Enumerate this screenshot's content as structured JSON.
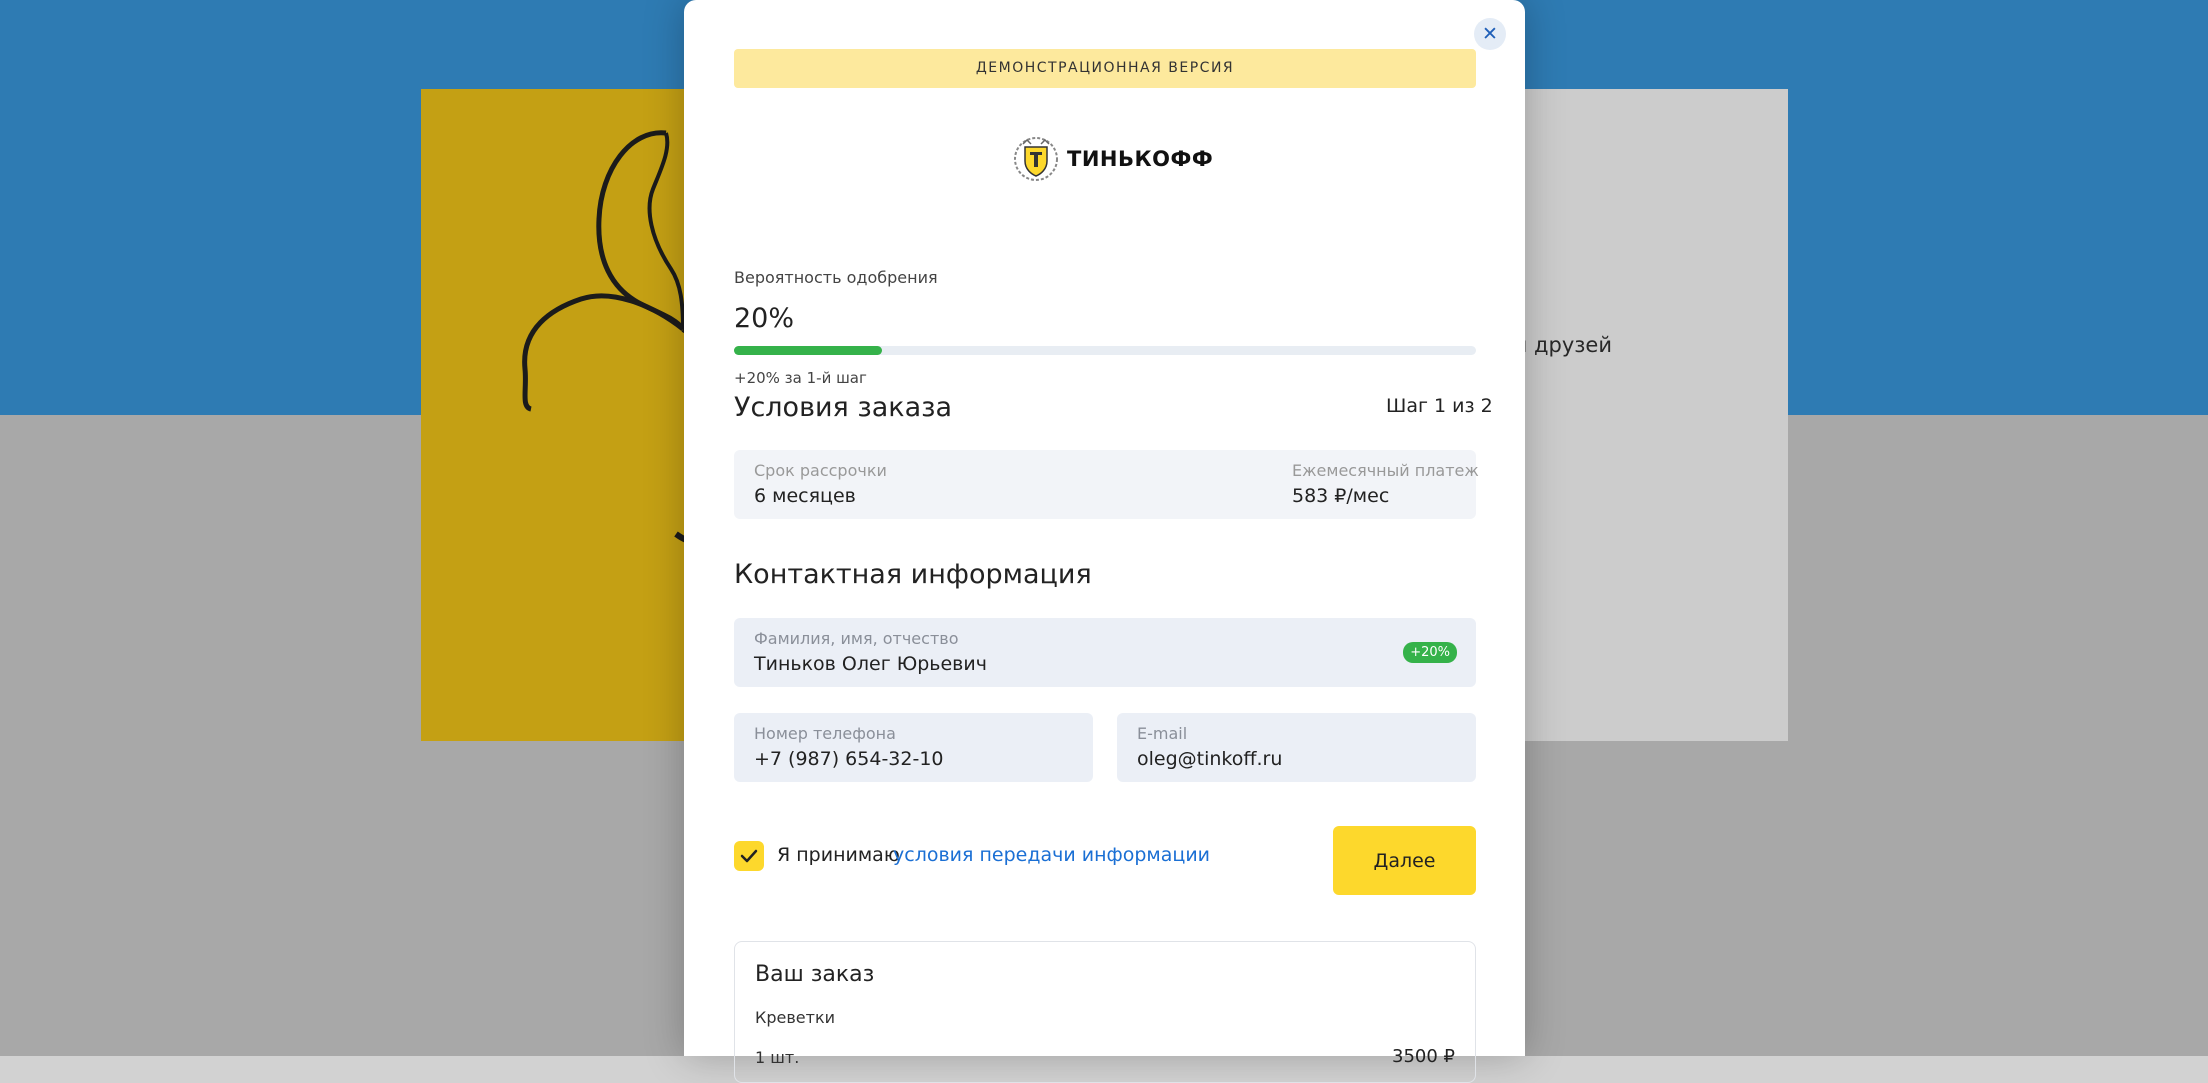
{
  "background": {
    "right_card_text": "ии друзей"
  },
  "modal": {
    "close_icon": "close-icon",
    "demo_banner": "ДЕМОНСТРАЦИОННАЯ ВЕРСИЯ",
    "logo_text": "ТИНЬКОФФ",
    "approval": {
      "label": "Вероятность одобрения",
      "value": "20%",
      "progress_fraction": 0.2,
      "hint": "+20% за 1-й шаг"
    },
    "order_title": "Условия заказа",
    "step": "Шаг 1 из 2",
    "terms": {
      "period_label": "Срок рассрочки",
      "period_value": "6 месяцев",
      "payment_label": "Ежемесячный платеж",
      "payment_value": "583 ₽/мес"
    },
    "contact_title": "Контактная информация",
    "fields": {
      "fullname_label": "Фамилия, имя, отчество",
      "fullname_value": "Тиньков Олег Юрьевич",
      "fullname_badge": "+20%",
      "phone_label": "Номер телефона",
      "phone_value": "+7 (987) 654-32-10",
      "email_label": "E-mail",
      "email_value": "oleg@tinkoff.ru"
    },
    "consent": {
      "checked": true,
      "text": "Я принимаю",
      "link": "условия передачи информации"
    },
    "next_button": "Далее",
    "summary": {
      "title": "Ваш заказ",
      "item": "Креветки",
      "qty": "1 шт.",
      "price": "3500 ₽"
    }
  },
  "colors": {
    "accent_yellow": "#fdd82c",
    "progress_green": "#35b24a",
    "link_blue": "#1a6fd4",
    "page_blue": "#3a9ae0"
  }
}
